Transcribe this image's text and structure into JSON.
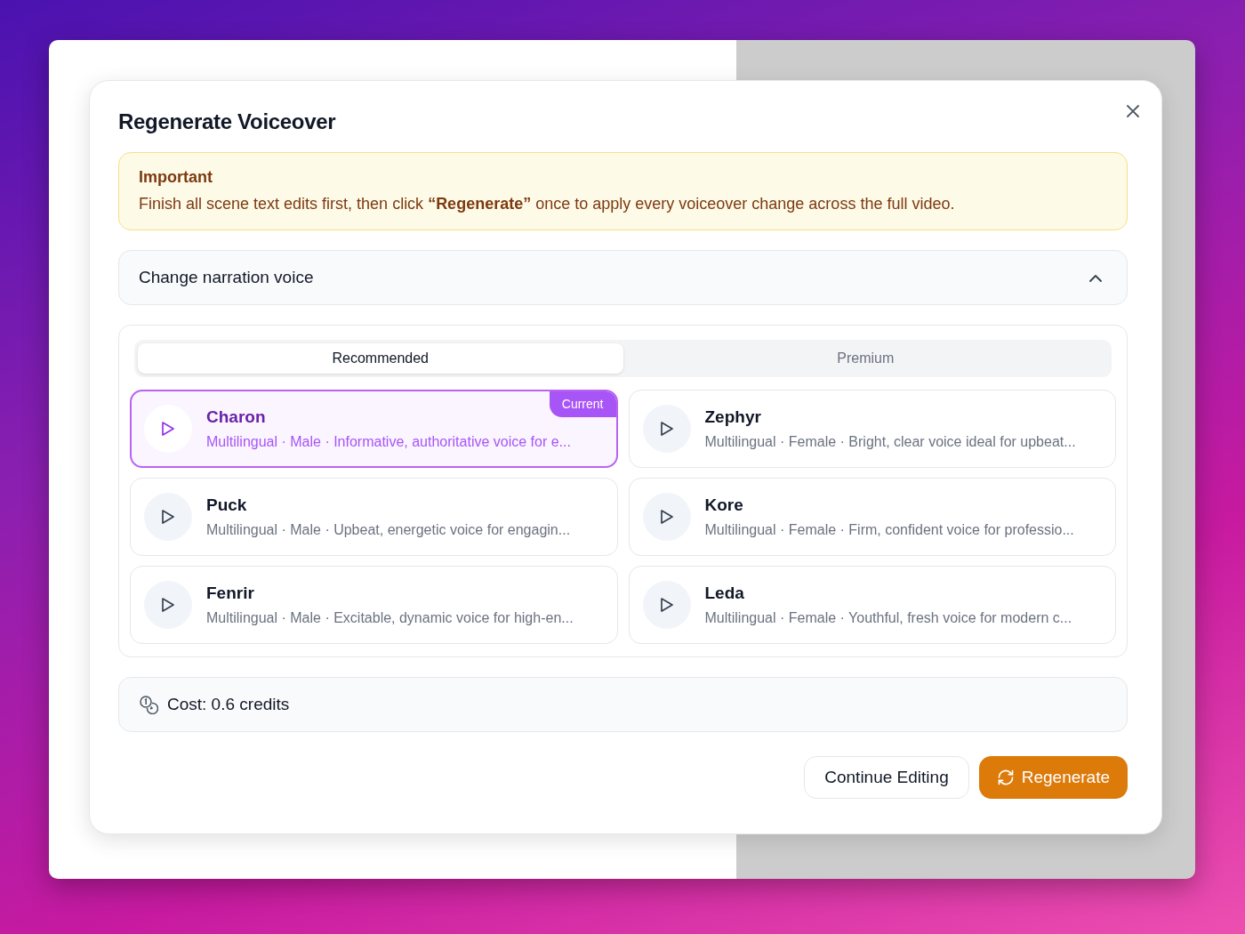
{
  "dialog": {
    "title": "Regenerate Voiceover"
  },
  "alert": {
    "title": "Important",
    "text": "Finish all scene text edits first, then click **“Regenerate”** once to apply every voiceover change across the full video."
  },
  "section": {
    "label": "Change narration voice",
    "expanded": true
  },
  "tabs": [
    {
      "label": "Recommended",
      "selected": true
    },
    {
      "label": "Premium",
      "selected": false
    }
  ],
  "voices": [
    {
      "name": "Charon",
      "description": "Multilingual · Male · Informative, authoritative voice for e...",
      "selected": true,
      "badge": "Current"
    },
    {
      "name": "Zephyr",
      "description": "Multilingual · Female · Bright, clear voice ideal for upbeat...",
      "selected": false
    },
    {
      "name": "Puck",
      "description": "Multilingual · Male · Upbeat, energetic voice for engagin...",
      "selected": false
    },
    {
      "name": "Kore",
      "description": "Multilingual · Female · Firm, confident voice for professio...",
      "selected": false
    },
    {
      "name": "Fenrir",
      "description": "Multilingual · Male · Excitable, dynamic voice for high-en...",
      "selected": false
    },
    {
      "name": "Leda",
      "description": "Multilingual · Female · Youthful, fresh voice for modern c...",
      "selected": false
    }
  ],
  "cost": "Cost: 0.6 credits",
  "buttons": [
    {
      "label": "Continue Editing",
      "kind": "secondary"
    },
    {
      "label": "Regenerate",
      "kind": "primary"
    }
  ]
}
